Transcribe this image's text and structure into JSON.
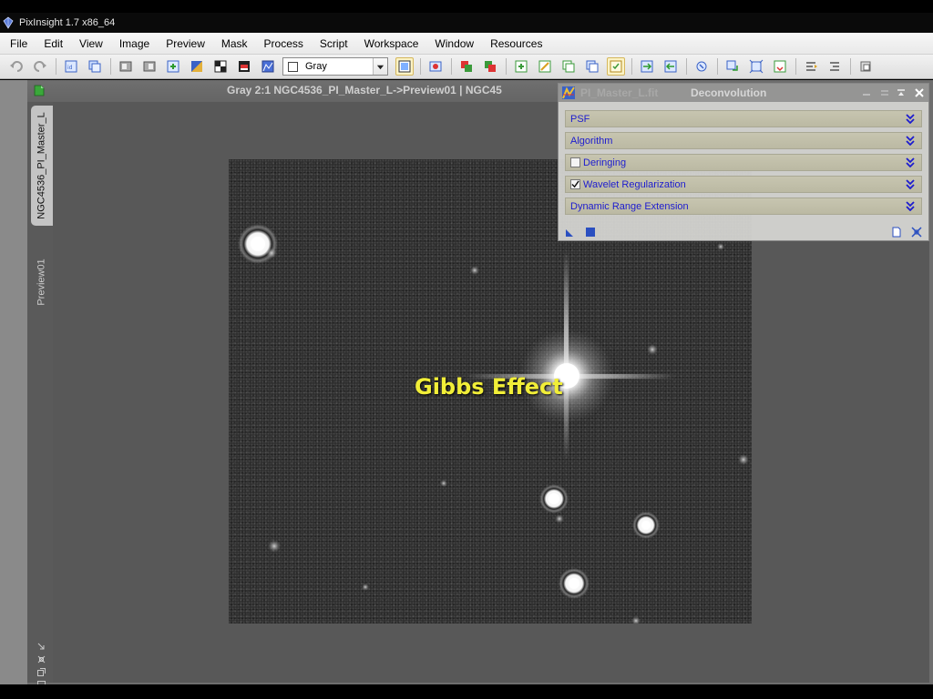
{
  "window": {
    "title": "PixInsight 1.7 x86_64"
  },
  "menu": [
    "File",
    "Edit",
    "View",
    "Image",
    "Preview",
    "Mask",
    "Process",
    "Script",
    "Workspace",
    "Window",
    "Resources"
  ],
  "toolbar": {
    "colorspace_selected": "Gray",
    "icons": [
      "undo-icon",
      "redo-icon",
      "identifier-icon",
      "clone-icon",
      "zoom-fit-icon",
      "zoom-icon",
      "new-preview-icon",
      "mask-icon",
      "stf-icon",
      "invert-icon",
      "histogram-icon",
      "display-channel-icon",
      "rgb-icon",
      "readout-icon",
      "color-icon",
      "new-window-icon",
      "edit-icon",
      "duplicate-icon",
      "reset-icon",
      "select-icon",
      "export-icon",
      "import-icon",
      "process-icon",
      "transfer-icon",
      "fit-icon",
      "save-icon",
      "align-left-icon",
      "align-right-icon",
      "settings-icon"
    ]
  },
  "image_window": {
    "title": "Gray 2:1 NGC4536_PI_Master_L->Preview01 | NGC45",
    "tabs": {
      "main": "NGC4536_PI_Master_L",
      "preview": "Preview01"
    }
  },
  "overlay_caption": "Gibbs Effect",
  "deconvolution": {
    "ghost_title": "PI_Master_L.fit",
    "title": "Deconvolution",
    "sections": [
      {
        "label": "PSF",
        "has_checkbox": false,
        "checked": false
      },
      {
        "label": "Algorithm",
        "has_checkbox": false,
        "checked": false
      },
      {
        "label": "Deringing",
        "has_checkbox": true,
        "checked": false
      },
      {
        "label": "Wavelet Regularization",
        "has_checkbox": true,
        "checked": true
      },
      {
        "label": "Dynamic Range Extension",
        "has_checkbox": false,
        "checked": false
      }
    ]
  },
  "colors": {
    "caption": "#f1ee38",
    "section_label": "#1d1ccf",
    "section_bg": "#c4c2ac",
    "workspace_bg": "#6e6e6e"
  }
}
